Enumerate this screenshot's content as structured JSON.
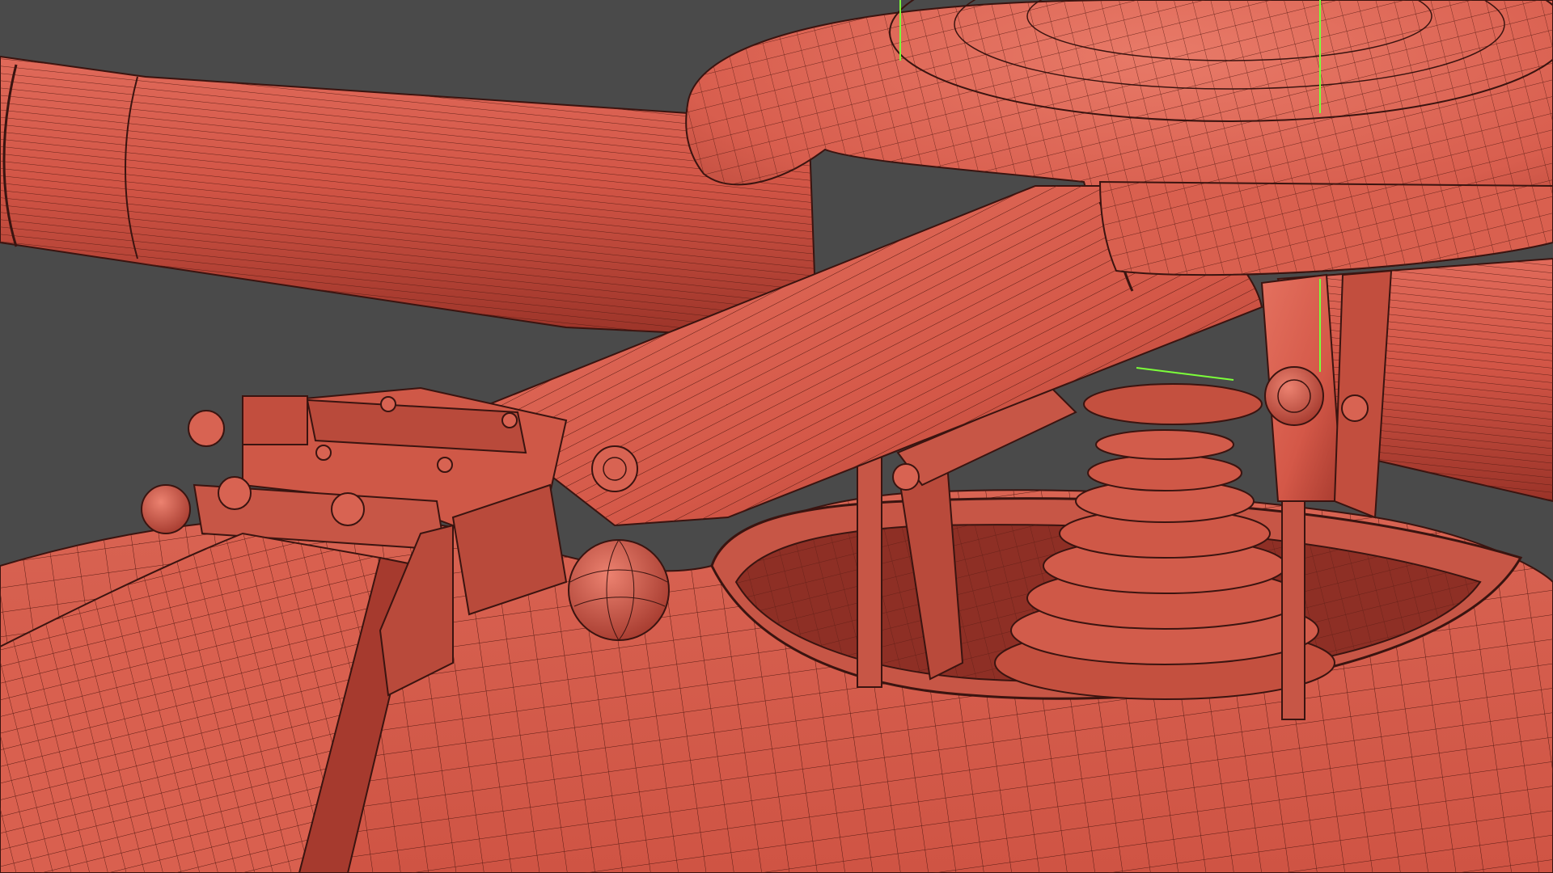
{
  "viewport": {
    "mode": "3d-perspective-wireframe-on-shaded",
    "background_color": "#4a4a4a",
    "mesh_color": "#d65a4c",
    "mesh_shade_color": "#a43c30",
    "wire_color": "#3a1410",
    "gizmo_color": "#7cff3a"
  }
}
